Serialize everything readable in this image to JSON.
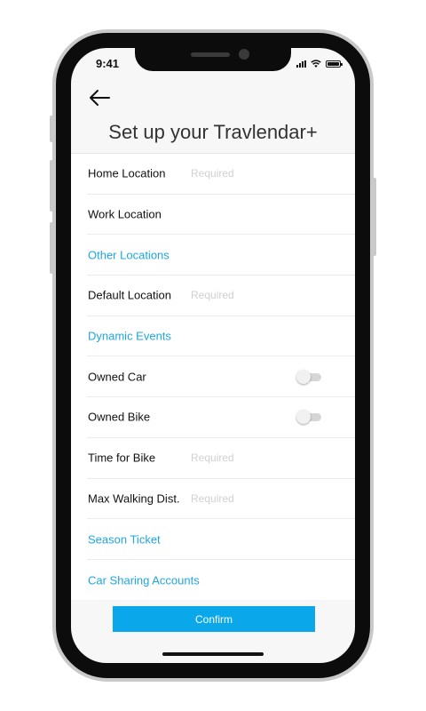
{
  "status_bar": {
    "time": "9:41"
  },
  "header": {
    "back_icon": "arrow-left-icon",
    "title": "Set up your Travlendar+"
  },
  "form": {
    "home_location": {
      "label": "Home Location",
      "placeholder": "Required",
      "value": ""
    },
    "work_location": {
      "label": "Work Location",
      "placeholder": "",
      "value": ""
    },
    "other_locations": {
      "label": "Other Locations"
    },
    "default_location": {
      "label": "Default Location",
      "placeholder": "Required",
      "value": ""
    },
    "dynamic_events": {
      "label": "Dynamic Events"
    },
    "owned_car": {
      "label": "Owned Car",
      "on": false
    },
    "owned_bike": {
      "label": "Owned Bike",
      "on": false
    },
    "time_for_bike": {
      "label": "Time for Bike",
      "placeholder": "Required",
      "value": ""
    },
    "max_walking_dist": {
      "label": "Max Walking Dist.",
      "placeholder": "Required",
      "value": ""
    },
    "season_ticket": {
      "label": "Season Ticket"
    },
    "car_sharing_accounts": {
      "label": "Car Sharing Accounts"
    }
  },
  "footer": {
    "confirm_label": "Confirm"
  },
  "colors": {
    "accent": "#1fa6de",
    "button": "#0aa8ea",
    "placeholder": "#d0d0d0"
  }
}
